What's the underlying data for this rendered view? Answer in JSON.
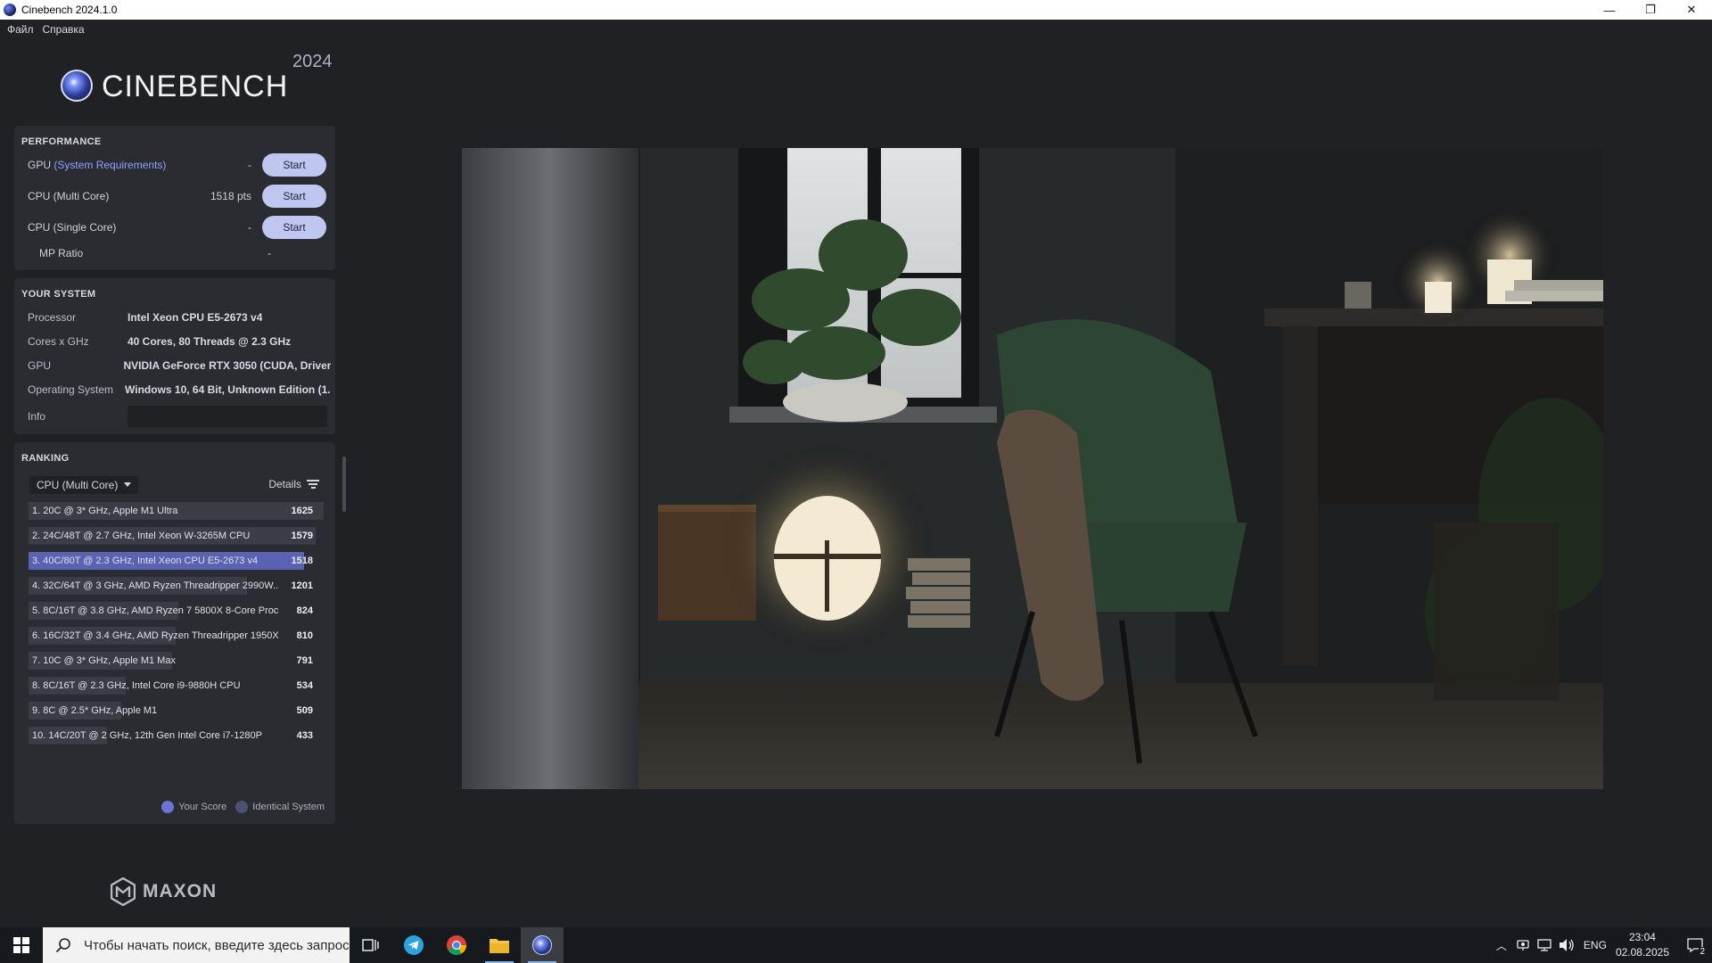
{
  "window": {
    "title": "Cinebench 2024.1.0",
    "minimize": "—",
    "restore": "❐",
    "close": "✕"
  },
  "menu": [
    "Файл",
    "Справка"
  ],
  "logo": {
    "name": "CINEBENCH",
    "year": "2024"
  },
  "performance": {
    "title": "PERFORMANCE",
    "gpu": {
      "label": "GPU",
      "link": "(System Requirements)",
      "value": "-",
      "button": "Start"
    },
    "cpu_multi": {
      "label": "CPU (Multi Core)",
      "value": "1518 pts",
      "button": "Start"
    },
    "cpu_single": {
      "label": "CPU (Single Core)",
      "value": "-",
      "button": "Start"
    },
    "mp_ratio": {
      "label": "MP Ratio",
      "value": "-"
    }
  },
  "system": {
    "title": "YOUR SYSTEM",
    "rows": [
      {
        "key": "Processor",
        "value": "Intel Xeon CPU E5-2673 v4"
      },
      {
        "key": "Cores x GHz",
        "value": "40 Cores, 80 Threads @ 2.3 GHz"
      },
      {
        "key": "GPU",
        "value": "NVIDIA GeForce RTX 3050 (CUDA, Driver..."
      },
      {
        "key": "Operating System",
        "value": "Windows 10, 64 Bit, Unknown Edition (1..."
      }
    ],
    "info_label": "Info"
  },
  "ranking": {
    "title": "RANKING",
    "select": "CPU (Multi Core)",
    "details": "Details",
    "rows": [
      {
        "name": "1. 20C @ 3* GHz, Apple M1 Ultra",
        "score": 1625
      },
      {
        "name": "2. 24C/48T @ 2.7 GHz, Intel Xeon W-3265M CPU",
        "score": 1579
      },
      {
        "name": "3. 40C/80T @ 2.3 GHz, Intel Xeon CPU E5-2673 v4",
        "score": 1518,
        "mine": true
      },
      {
        "name": "4. 32C/64T @ 3 GHz, AMD Ryzen Threadripper 2990W...",
        "score": 1201
      },
      {
        "name": "5. 8C/16T @ 3.8 GHz, AMD Ryzen 7 5800X 8-Core Proce...",
        "score": 824
      },
      {
        "name": "6. 16C/32T @ 3.4 GHz, AMD Ryzen Threadripper 1950X ...",
        "score": 810
      },
      {
        "name": "7. 10C @ 3* GHz, Apple M1 Max",
        "score": 791
      },
      {
        "name": "8. 8C/16T @ 2.3 GHz, Intel Core i9-9880H CPU",
        "score": 534
      },
      {
        "name": "9. 8C @ 2.5* GHz, Apple M1",
        "score": 509
      },
      {
        "name": "10. 14C/20T @ 2 GHz, 12th Gen Intel Core i7-1280P",
        "score": 433
      }
    ],
    "legend": {
      "your_score": "Your Score",
      "identical": "Identical System"
    }
  },
  "brand": "MAXON",
  "taskbar": {
    "search_placeholder": "Чтобы начать поиск, введите здесь запрос",
    "lang": "ENG",
    "time": "23:04",
    "date": "02.08.2025",
    "notifications": "2"
  },
  "colors": {
    "accent": "#5a62b4",
    "button": "#bfc6ef",
    "panel": "#2a2c31",
    "background": "#1f2125"
  }
}
